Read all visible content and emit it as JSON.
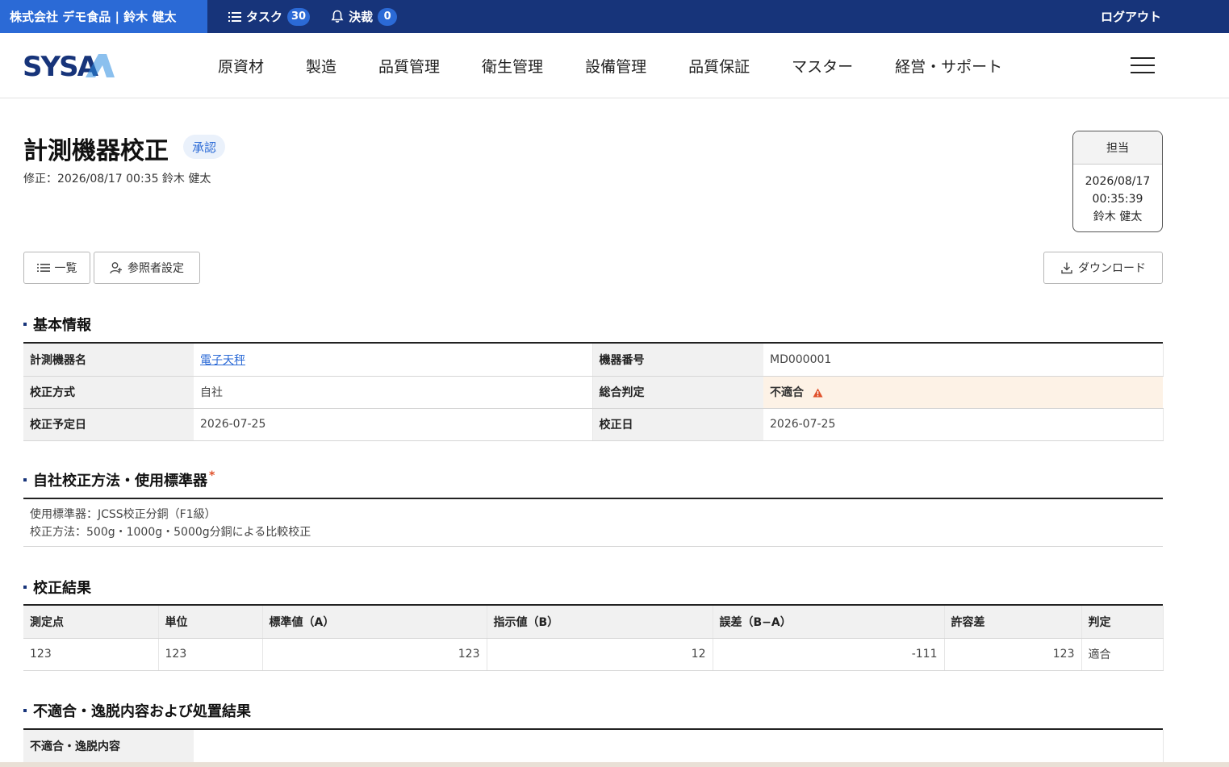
{
  "topbar": {
    "company_user": "株式会社 デモ食品 | 鈴木 健太",
    "tasks_label": "タスク",
    "tasks_count": "30",
    "approvals_label": "決裁",
    "approvals_count": "0",
    "logout_label": "ログアウト"
  },
  "nav": {
    "logo_text": "SYSA",
    "items": [
      "原資材",
      "製造",
      "品質管理",
      "衛生管理",
      "設備管理",
      "品質保証",
      "マスター",
      "経営・サポート"
    ]
  },
  "page": {
    "title": "計測機器校正",
    "status": "承認",
    "modified": "修正：2026/08/17 00:35  鈴木 健太"
  },
  "assignee": {
    "header": "担当",
    "date": "2026/08/17",
    "time": "00:35:39",
    "name": "鈴木 健太"
  },
  "buttons": {
    "list": "一覧",
    "viewers": "参照者設定",
    "download": "ダウンロード"
  },
  "basic": {
    "title": "基本情報",
    "rows": [
      {
        "label1": "計測機器名",
        "value1": "電子天秤",
        "label2": "機器番号",
        "value2": "MD000001"
      },
      {
        "label1": "校正方式",
        "value1": "自社",
        "label2": "総合判定",
        "value2": "不適合"
      },
      {
        "label1": "校正予定日",
        "value1": "2026-07-25",
        "label2": "校正日",
        "value2": "2026-07-25"
      }
    ]
  },
  "method": {
    "title": "自社校正方法・使用標準器",
    "required_mark": "*",
    "line1": "使用標準器：JCSS校正分銅（F1級）",
    "line2": "校正方法：500g・1000g・5000g分銅による比較校正"
  },
  "results": {
    "title": "校正結果",
    "headers": [
      "測定点",
      "単位",
      "標準値（A）",
      "指示値（B）",
      "誤差（B−A）",
      "許容差",
      "判定"
    ],
    "rows": [
      [
        "123",
        "123",
        "123",
        "12",
        "-111",
        "123",
        "適合"
      ]
    ]
  },
  "nonconformity": {
    "title": "不適合・逸脱内容および処置結果",
    "label": "不適合・逸脱内容",
    "value": ""
  },
  "colors": {
    "topbar": "#17347a",
    "accent": "#2b6ad6",
    "warning": "#e0522c",
    "warning_bg": "#fdf2e6"
  }
}
